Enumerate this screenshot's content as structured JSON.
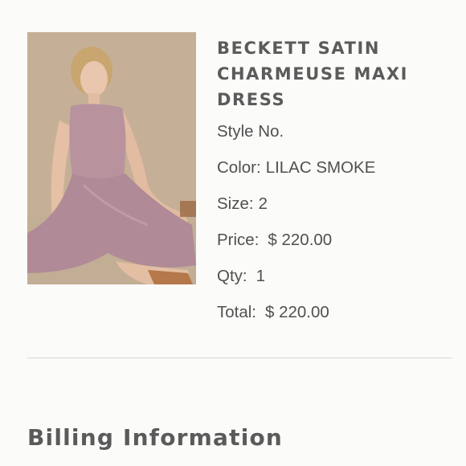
{
  "product": {
    "image_alt": "Woman seated wearing lilac satin maxi dress",
    "name": "BECKETT SATIN CHARMEUSE MAXI DRESS",
    "style_label": "Style No.",
    "color_label": "Color:",
    "color_value": "LILAC SMOKE",
    "size_label": "Size:",
    "size_value": "2",
    "price_label": "Price:",
    "price_value": "$ 220.00",
    "qty_label": "Qty:",
    "qty_value": "1",
    "total_label": "Total:",
    "total_value": "$ 220.00"
  },
  "billing": {
    "title": "Billing Information"
  },
  "colors": {
    "text": "#505050",
    "divider": "#d6d6d6",
    "dress": "#b8939e"
  }
}
